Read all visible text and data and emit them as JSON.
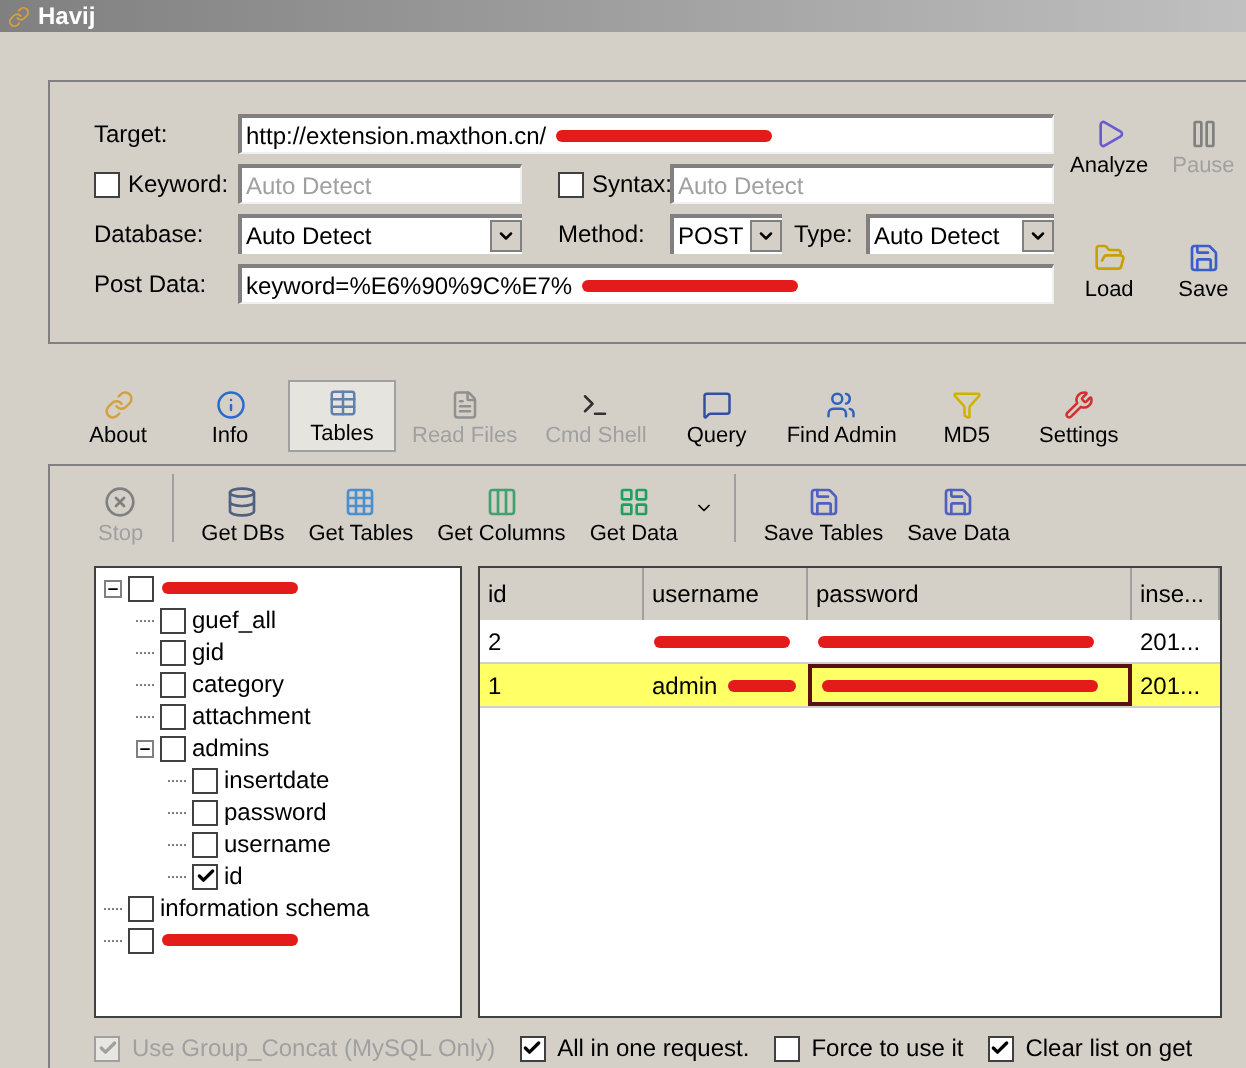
{
  "window": {
    "title": "Havij"
  },
  "target": {
    "label": "Target:",
    "value": "http://extension.maxthon.cn/",
    "redacted": true
  },
  "keyword": {
    "label": "Keyword:",
    "checked": false,
    "placeholder": "Auto Detect"
  },
  "syntax": {
    "label": "Syntax:",
    "checked": false,
    "placeholder": "Auto Detect"
  },
  "database": {
    "label": "Database:",
    "value": "Auto Detect"
  },
  "method": {
    "label": "Method:",
    "value": "POST"
  },
  "type": {
    "label": "Type:",
    "value": "Auto Detect"
  },
  "post_data": {
    "label": "Post Data:",
    "value": "keyword=%E6%90%9C%E7%",
    "redacted": true
  },
  "side_buttons": [
    {
      "kind": "analyze",
      "label": "Analyze",
      "disabled": false
    },
    {
      "kind": "pause",
      "label": "Pause",
      "disabled": true
    },
    {
      "kind": "load",
      "label": "Load",
      "disabled": false
    },
    {
      "kind": "save",
      "label": "Save",
      "disabled": false
    }
  ],
  "tabs": [
    {
      "kind": "about",
      "label": "About",
      "selected": false,
      "disabled": false
    },
    {
      "kind": "info",
      "label": "Info",
      "selected": false,
      "disabled": false
    },
    {
      "kind": "tables",
      "label": "Tables",
      "selected": true,
      "disabled": false
    },
    {
      "kind": "files",
      "label": "Read Files",
      "selected": false,
      "disabled": true
    },
    {
      "kind": "shell",
      "label": "Cmd Shell",
      "selected": false,
      "disabled": true
    },
    {
      "kind": "query",
      "label": "Query",
      "selected": false,
      "disabled": false
    },
    {
      "kind": "admin",
      "label": "Find Admin",
      "selected": false,
      "disabled": false
    },
    {
      "kind": "md5",
      "label": "MD5",
      "selected": false,
      "disabled": false
    },
    {
      "kind": "settings",
      "label": "Settings",
      "selected": false,
      "disabled": false
    }
  ],
  "actions": [
    {
      "kind": "stop",
      "label": "Stop",
      "disabled": true
    },
    {
      "kind": "dbs",
      "label": "Get DBs",
      "disabled": false
    },
    {
      "kind": "tables",
      "label": "Get Tables",
      "disabled": false
    },
    {
      "kind": "columns",
      "label": "Get Columns",
      "disabled": false
    },
    {
      "kind": "data",
      "label": "Get Data",
      "disabled": false
    },
    {
      "kind": "save_tables",
      "label": "Save Tables",
      "disabled": false
    },
    {
      "kind": "save_data",
      "label": "Save Data",
      "disabled": false
    }
  ],
  "tree": [
    {
      "redacted": true,
      "checked": false,
      "expanded": true,
      "children": [
        {
          "label": "guef_all",
          "checked": false
        },
        {
          "label": "gid",
          "checked": false
        },
        {
          "label": "category",
          "checked": false
        },
        {
          "label": "attachment",
          "checked": false
        },
        {
          "label": "admins",
          "checked": false,
          "expanded": true,
          "children": [
            {
              "label": "insertdate",
              "checked": false
            },
            {
              "label": "password",
              "checked": false
            },
            {
              "label": "username",
              "checked": false
            },
            {
              "label": "id",
              "checked": true
            }
          ]
        }
      ]
    },
    {
      "label": "information schema",
      "checked": false
    },
    {
      "redacted": true,
      "checked": false
    }
  ],
  "table": {
    "columns": [
      "id",
      "username",
      "password",
      "inse..."
    ],
    "rows": [
      {
        "selected": false,
        "cells": [
          {
            "text": "2"
          },
          {
            "redacted": true
          },
          {
            "redacted": true
          },
          {
            "text": "201..."
          }
        ]
      },
      {
        "selected": true,
        "cells": [
          {
            "text": "1"
          },
          {
            "text": "admin",
            "redacted": true
          },
          {
            "redacted": true
          },
          {
            "text": "201..."
          }
        ]
      }
    ]
  },
  "options": [
    {
      "label": "Use Group_Concat (MySQL Only)",
      "checked": true,
      "disabled": true
    },
    {
      "label": "All in one request.",
      "checked": true,
      "disabled": false
    },
    {
      "label": "Force to use it",
      "checked": false,
      "disabled": false
    },
    {
      "label": "Clear list on get",
      "checked": true,
      "disabled": false
    }
  ]
}
